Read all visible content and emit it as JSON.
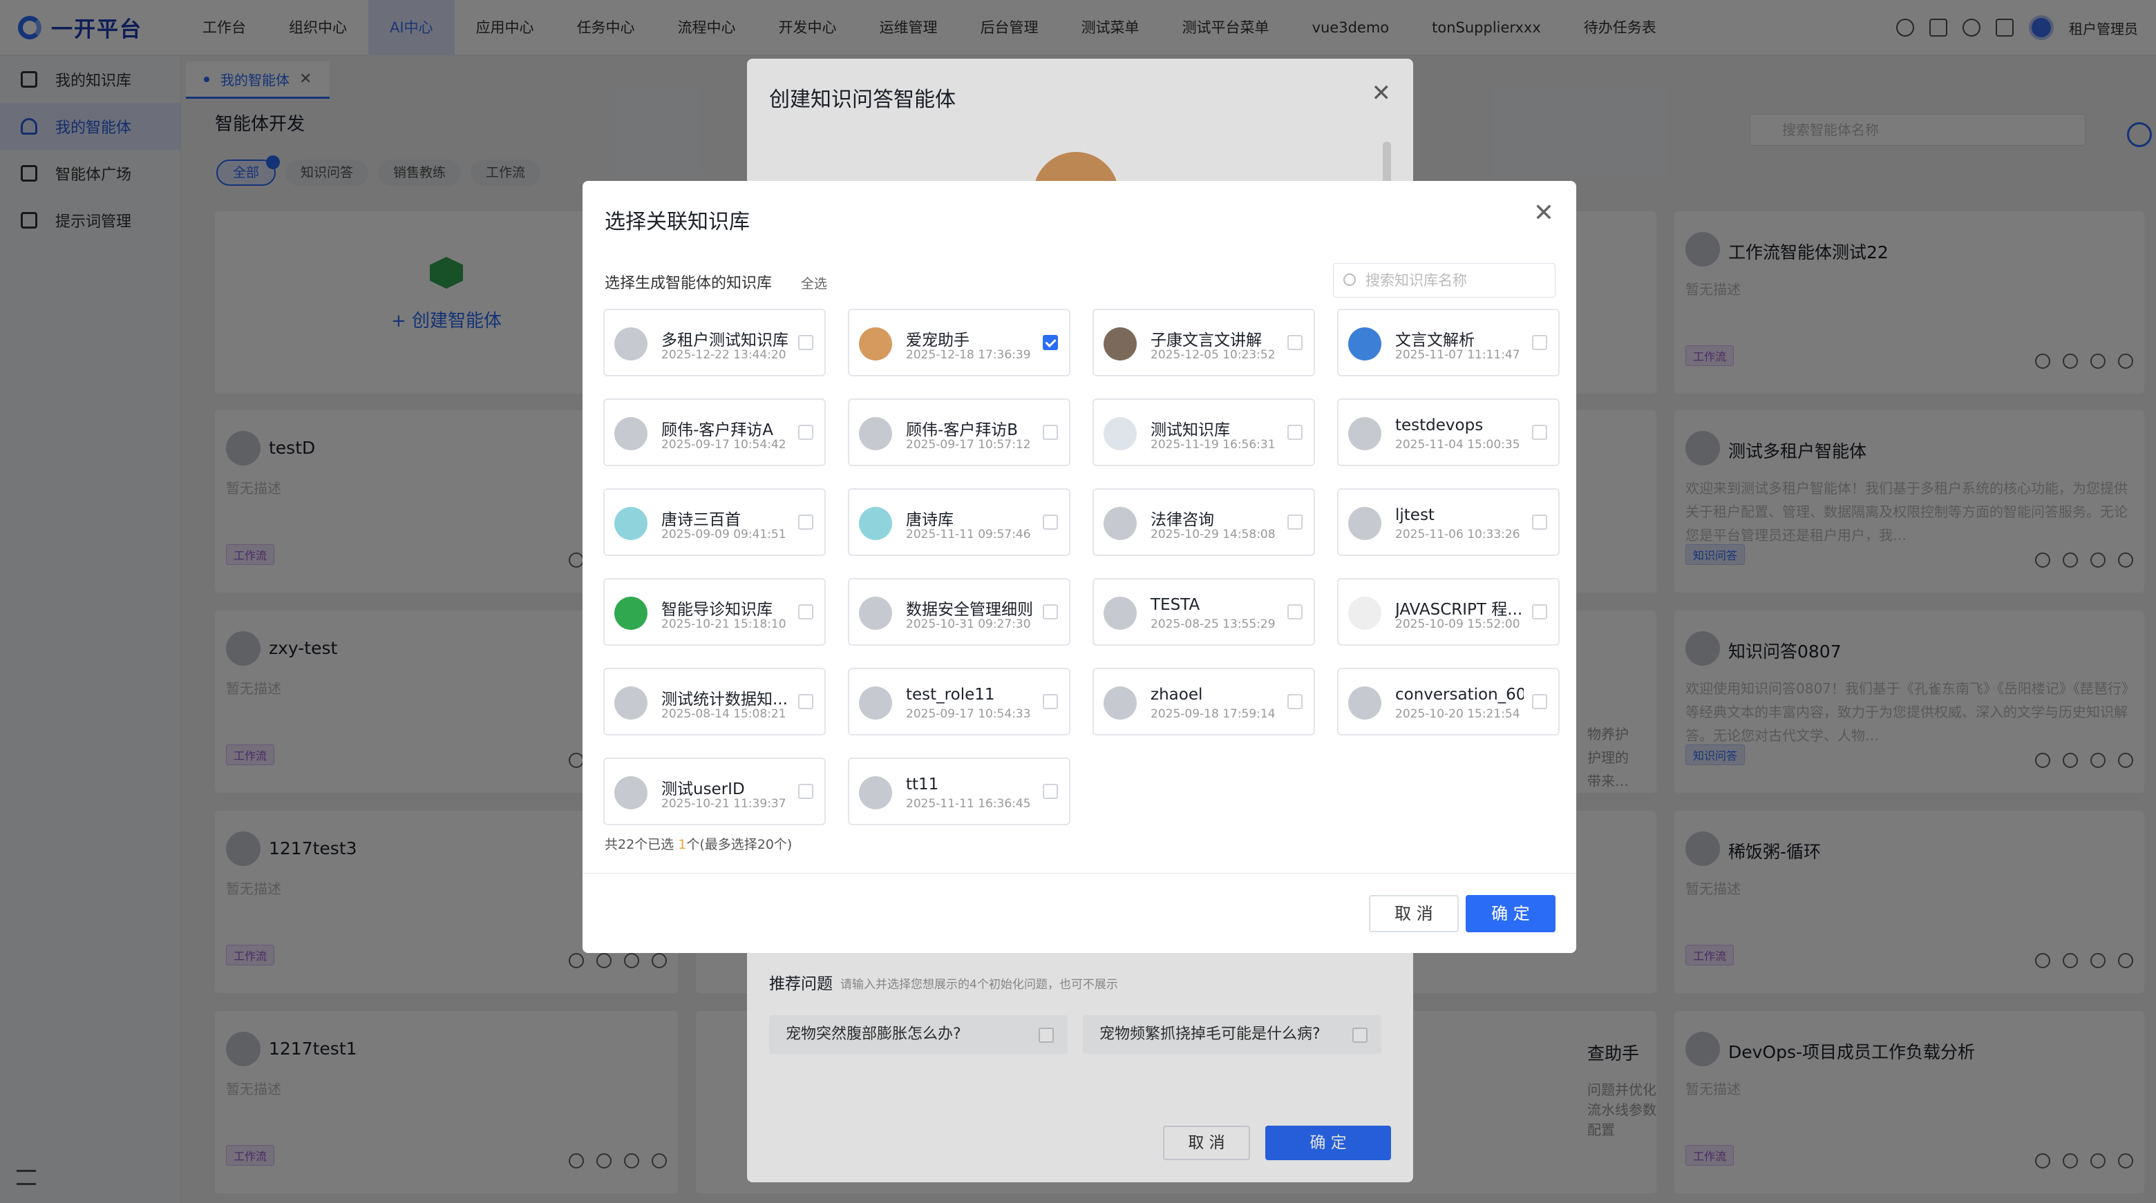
{
  "app": {
    "name": "一开平台"
  },
  "nav": [
    "工作台",
    "组织中心",
    "AI中心",
    "应用中心",
    "任务中心",
    "流程中心",
    "开发中心",
    "运维管理",
    "后台管理",
    "测试菜单",
    "测试平台菜单",
    "vue3demo",
    "tonSupplierxxx",
    "待办任务表"
  ],
  "user": {
    "name": "租户管理员"
  },
  "sidebar": [
    "我的知识库",
    "我的智能体",
    "智能体广场",
    "提示词管理"
  ],
  "tab": "我的智能体",
  "page_title": "智能体开发",
  "filters": [
    "全部",
    "知识问答",
    "销售教练",
    "工作流"
  ],
  "bg_search_placeholder": "搜索智能体名称",
  "create_label": "+ 创建智能体",
  "cards": [
    {
      "title": "工作流智能体测试22",
      "desc": "暂无描述",
      "tag": "工作流"
    },
    {
      "title": "testD",
      "desc": "暂无描述",
      "tag": "工作流"
    },
    {
      "title": "测试多租户智能体",
      "desc": "欢迎来到测试多租户智能体！我们基于多租户系统的核心功能，为您提供关于租户配置、管理、数据隔离及权限控制等方面的智能问答服务。无论您是平台管理员还是租户用户，我…",
      "tag": "知识问答"
    },
    {
      "title": "zxy-test",
      "desc": "暂无描述",
      "tag": "工作流"
    },
    {
      "title": "知识问答0807",
      "desc": "欢迎使用知识问答0807！我们基于《孔雀东南飞》《岳阳楼记》《琵琶行》等经典文本的丰富内容，致力于为您提供权威、深入的文学与历史知识解答。无论您对古代文学、人物…",
      "tag": "知识问答"
    },
    {
      "title": "1217test3",
      "desc": "暂无描述",
      "tag": "工作流"
    },
    {
      "title": "稀饭粥-循环",
      "desc": "暂无描述",
      "tag": "工作流"
    },
    {
      "title": "1217test1",
      "desc": "暂无描述",
      "tag": "工作流"
    },
    {
      "title": "DevOps-项目成员工作负载分析",
      "desc": "暂无描述",
      "tag": "工作流"
    }
  ],
  "partial": {
    "mid_text1": "物养护",
    "mid_text2": "护理的",
    "mid_text3": "带来…",
    "b_title": "查助手",
    "b_desc": "问题并优化流水线参数配置"
  },
  "modal1": {
    "title": "创建知识问答智能体",
    "recommend_label": "推荐问题",
    "recommend_hint": "请输入并选择您想展示的4个初始化问题，也可不展示",
    "questions": [
      "宠物突然腹部膨胀怎么办?",
      "宠物频繁抓挠掉毛可能是什么病?"
    ],
    "cancel": "取 消",
    "ok": "确 定"
  },
  "modal2": {
    "title": "选择关联知识库",
    "label": "选择生成智能体的知识库",
    "select_all": "全选",
    "search_placeholder": "搜索知识库名称",
    "items": [
      {
        "name": "多租户测试知识库",
        "date": "2025-12-22 13:44:20",
        "icon": "av",
        "checked": false
      },
      {
        "name": "爱宠助手",
        "date": "2025-12-18 17:36:39",
        "icon": "pet",
        "checked": true
      },
      {
        "name": "子康文言文讲解",
        "date": "2025-12-05 10:23:52",
        "icon": "photo",
        "checked": false
      },
      {
        "name": "文言文解析",
        "date": "2025-11-07 11:11:47",
        "icon": "blue",
        "checked": false
      },
      {
        "name": "顾伟-客户拜访A",
        "date": "2025-09-17 10:54:42",
        "icon": "av",
        "checked": false
      },
      {
        "name": "顾伟-客户拜访B",
        "date": "2025-09-17 10:57:12",
        "icon": "av",
        "checked": false
      },
      {
        "name": "测试知识库",
        "date": "2025-11-19 16:56:31",
        "icon": "dots",
        "checked": false
      },
      {
        "name": "testdevops",
        "date": "2025-11-04 15:00:35",
        "icon": "av",
        "checked": false
      },
      {
        "name": "唐诗三百首",
        "date": "2025-09-09 09:41:51",
        "icon": "teal",
        "checked": false
      },
      {
        "name": "唐诗库",
        "date": "2025-11-11 09:57:46",
        "icon": "teal",
        "checked": false
      },
      {
        "name": "法律咨询",
        "date": "2025-10-29 14:58:08",
        "icon": "av",
        "checked": false
      },
      {
        "name": "ljtest",
        "date": "2025-11-06 10:33:26",
        "icon": "av",
        "checked": false
      },
      {
        "name": "智能导诊知识库",
        "date": "2025-10-21 15:18:10",
        "icon": "green",
        "checked": false
      },
      {
        "name": "数据安全管理细则",
        "date": "2025-10-31 09:27:30",
        "icon": "av",
        "checked": false
      },
      {
        "name": "TESTA",
        "date": "2025-08-25 13:55:29",
        "icon": "av",
        "checked": false
      },
      {
        "name": "JAVASCRIPT 程...",
        "date": "2025-10-09 15:52:00",
        "icon": "doc",
        "checked": false
      },
      {
        "name": "测试统计数据知...",
        "date": "2025-08-14 15:08:21",
        "icon": "av",
        "checked": false
      },
      {
        "name": "test_role11",
        "date": "2025-09-17 10:54:33",
        "icon": "av",
        "checked": false
      },
      {
        "name": "zhaoel",
        "date": "2025-09-18 17:59:14",
        "icon": "av",
        "checked": false
      },
      {
        "name": "conversation_60...",
        "date": "2025-10-20 15:21:54",
        "icon": "av",
        "checked": false
      },
      {
        "name": "测试userID",
        "date": "2025-10-21 11:39:37",
        "icon": "av",
        "checked": false
      },
      {
        "name": "tt11",
        "date": "2025-11-11 16:36:45",
        "icon": "av",
        "checked": false
      }
    ],
    "count_prefix": "共22个已选 ",
    "count_num": "1",
    "count_suffix": "个(最多选择20个)",
    "cancel": "取 消",
    "ok": "确 定"
  },
  "colors": {
    "accent": "#2b6cf6",
    "workflow_tag": "#9b59d0"
  }
}
